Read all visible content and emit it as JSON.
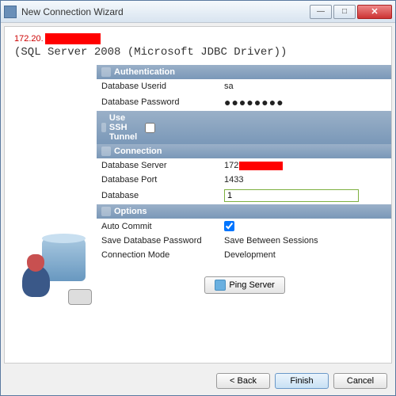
{
  "window": {
    "title": "New Connection Wizard"
  },
  "header": {
    "ip": "172.20.",
    "sub": "(SQL Server 2008 (Microsoft JDBC Driver))"
  },
  "sections": {
    "auth": "Authentication",
    "ssh": "Use SSH Tunnel",
    "conn": "Connection",
    "opts": "Options"
  },
  "fields": {
    "userid": {
      "label": "Database Userid",
      "value": "sa"
    },
    "password": {
      "label": "Database Password",
      "masked": "●●●●●●●●"
    },
    "server": {
      "label": "Database Server",
      "value": "172"
    },
    "port": {
      "label": "Database Port",
      "value": "1433"
    },
    "database": {
      "label": "Database",
      "value": "1"
    },
    "autocommit": {
      "label": "Auto Commit",
      "checked": true
    },
    "savepw": {
      "label": "Save Database Password",
      "value": "Save Between Sessions"
    },
    "connmode": {
      "label": "Connection Mode",
      "value": "Development"
    }
  },
  "buttons": {
    "ping": "Ping Server",
    "back": "< Back",
    "finish": "Finish",
    "cancel": "Cancel"
  }
}
